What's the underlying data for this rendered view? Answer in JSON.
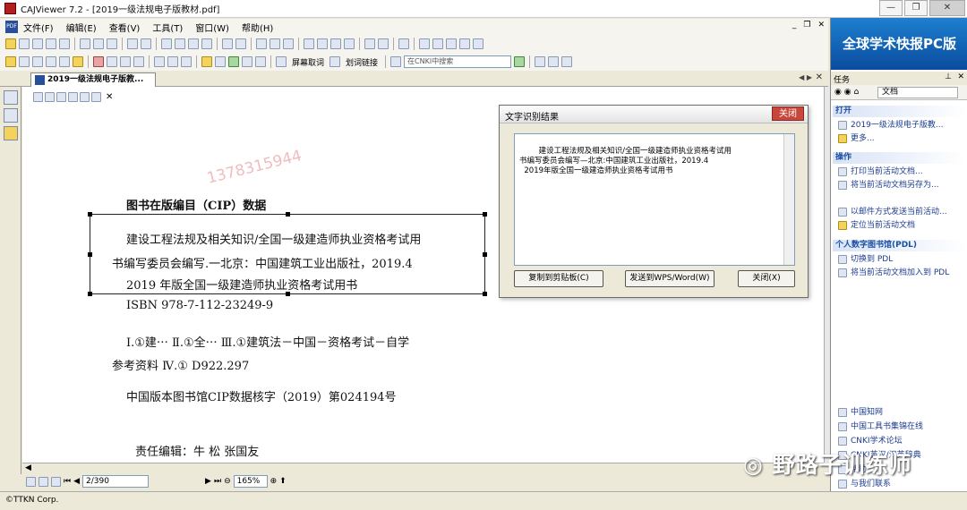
{
  "window": {
    "title": "CAJViewer 7.2 - [2019一级法规电子版教材.pdf]"
  },
  "menu": {
    "items": [
      "文件(F)",
      "编辑(E)",
      "查看(V)",
      "工具(T)",
      "窗口(W)",
      "帮助(H)"
    ]
  },
  "toolbar": {
    "subtitle_label": "屏幕取词",
    "link_label": "划词链接",
    "search_placeholder": "在CNKI中搜索"
  },
  "tab": {
    "label": "2019一级法规电子版教..."
  },
  "document": {
    "watermark": "1378315944",
    "cip_title": "图书在版编目（CIP）数据",
    "line1": "建设工程法规及相关知识/全国一级建造师执业资格考试用",
    "line2": "书编写委员会编写.一北京：中国建筑工业出版社，2019.4",
    "line3": "2019 年版全国一级建造师执业资格考试用书",
    "isbn": "ISBN 978-7-112-23249-9",
    "class1": "Ⅰ.①建⋯  Ⅱ.①全⋯  Ⅲ.①建筑法－中国－资格考试－自学",
    "class2": "参考资料  Ⅳ.① D922.297",
    "cip_no": "中国版本图书馆CIP数据核字（2019）第024194号",
    "editor": "责任编辑：牛    松    张国友"
  },
  "pagebar": {
    "page": "2/390",
    "zoom": "165%"
  },
  "status": {
    "text": "©TTKN Corp."
  },
  "dialog": {
    "title": "文字识别结果",
    "close": "关闭",
    "text": "  建设工程法规及相关知识/全国一级建造师执业资格考试用\n书编写委员会编写—北京:中国建筑工业出版社，2019.4\n  2019年版全国一级建造师执业资格考试用书",
    "copy_button": "复制到剪贴板(C)",
    "send_button": "发送到WPS/Word(W)",
    "close_button": "关闭(X)"
  },
  "rightpane": {
    "banner": "全球学术快报PC版",
    "task_header": "任务",
    "doc_select": "文档",
    "open_section": "打开",
    "open_items": [
      "2019一级法规电子版教...",
      "更多..."
    ],
    "ops_section": "操作",
    "ops_items": [
      "打印当前活动文档...",
      "将当前活动文档另存为...",
      "以邮件方式发送当前活动...",
      "定位当前活动文档"
    ],
    "pdl_section": "个人数字图书馆(PDL)",
    "pdl_items": [
      "切换到 PDL",
      "将当前活动文档加入到 PDL"
    ],
    "links": [
      "中国知网",
      "中国工具书集锦在线",
      "CNKI学术论坛",
      "CNKI英汉/汉英辞典",
      "帮助",
      "与我们联系"
    ]
  },
  "overlay": {
    "wechat": "野路子训练师"
  }
}
